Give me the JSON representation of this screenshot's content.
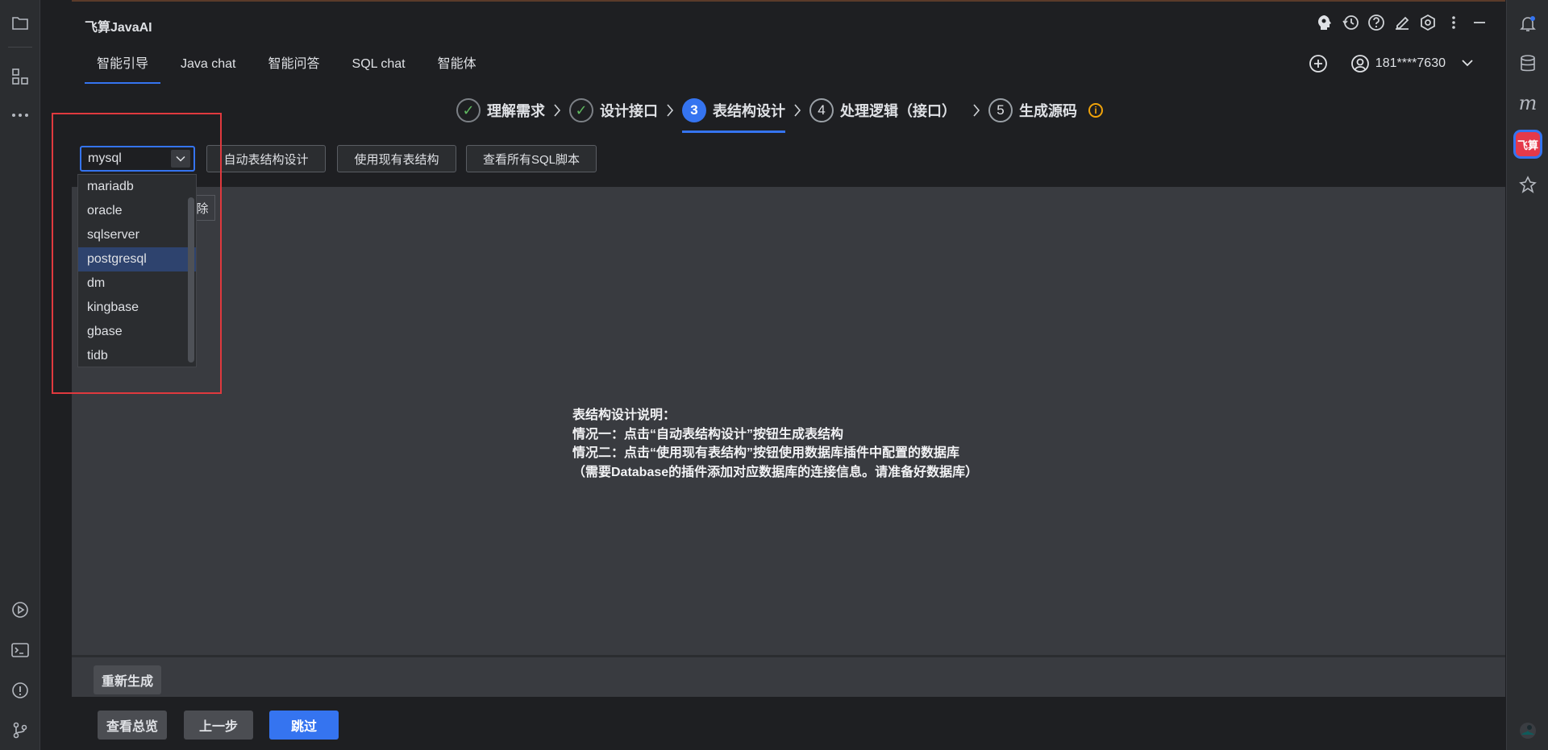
{
  "app": {
    "title": "飞算JavaAI"
  },
  "tabs": [
    {
      "label": "智能引导",
      "active": true
    },
    {
      "label": "Java chat",
      "active": false
    },
    {
      "label": "智能问答",
      "active": false
    },
    {
      "label": "SQL chat",
      "active": false
    },
    {
      "label": "智能体",
      "active": false
    }
  ],
  "user": {
    "name": "181****7630"
  },
  "steps": [
    {
      "number": "✓",
      "label": "理解需求",
      "state": "done"
    },
    {
      "number": "✓",
      "label": "设计接口",
      "state": "done"
    },
    {
      "number": "3",
      "label": "表结构设计",
      "state": "current"
    },
    {
      "number": "4",
      "label": "处理逻辑（接口）",
      "state": "todo"
    },
    {
      "number": "5",
      "label": "生成源码",
      "state": "todo"
    }
  ],
  "toolbar": {
    "db_selected": "mysql",
    "auto_design": "自动表结构设计",
    "use_existing": "使用现有表结构",
    "view_sql": "查看所有SQL脚本",
    "hidden_button_fragment": "除"
  },
  "db_options": [
    {
      "label": "mariadb"
    },
    {
      "label": "oracle"
    },
    {
      "label": "sqlserver"
    },
    {
      "label": "postgresql",
      "highlighted": true
    },
    {
      "label": "dm"
    },
    {
      "label": "kingbase"
    },
    {
      "label": "gbase"
    },
    {
      "label": "tidb"
    }
  ],
  "description": {
    "title": "表结构设计说明：",
    "line1": "情况一：点击“自动表结构设计”按钮生成表结构",
    "line2": "情况二：点击“使用现有表结构”按钮使用数据库插件中配置的数据库",
    "line3": "（需要Database的插件添加对应数据库的连接信息。请准备好数据库）"
  },
  "bottom": {
    "regenerate": "重新生成"
  },
  "footer": {
    "overview": "查看总览",
    "prev": "上一步",
    "skip": "跳过"
  },
  "right_strip": {
    "m_letter": "m",
    "feisuan_label": "飞算"
  },
  "colors": {
    "accent": "#3574f0",
    "highlight_box": "#e0393e",
    "warning": "#f0a30a",
    "panel_bg": "#1e1f22",
    "content_bg": "#393b40"
  }
}
